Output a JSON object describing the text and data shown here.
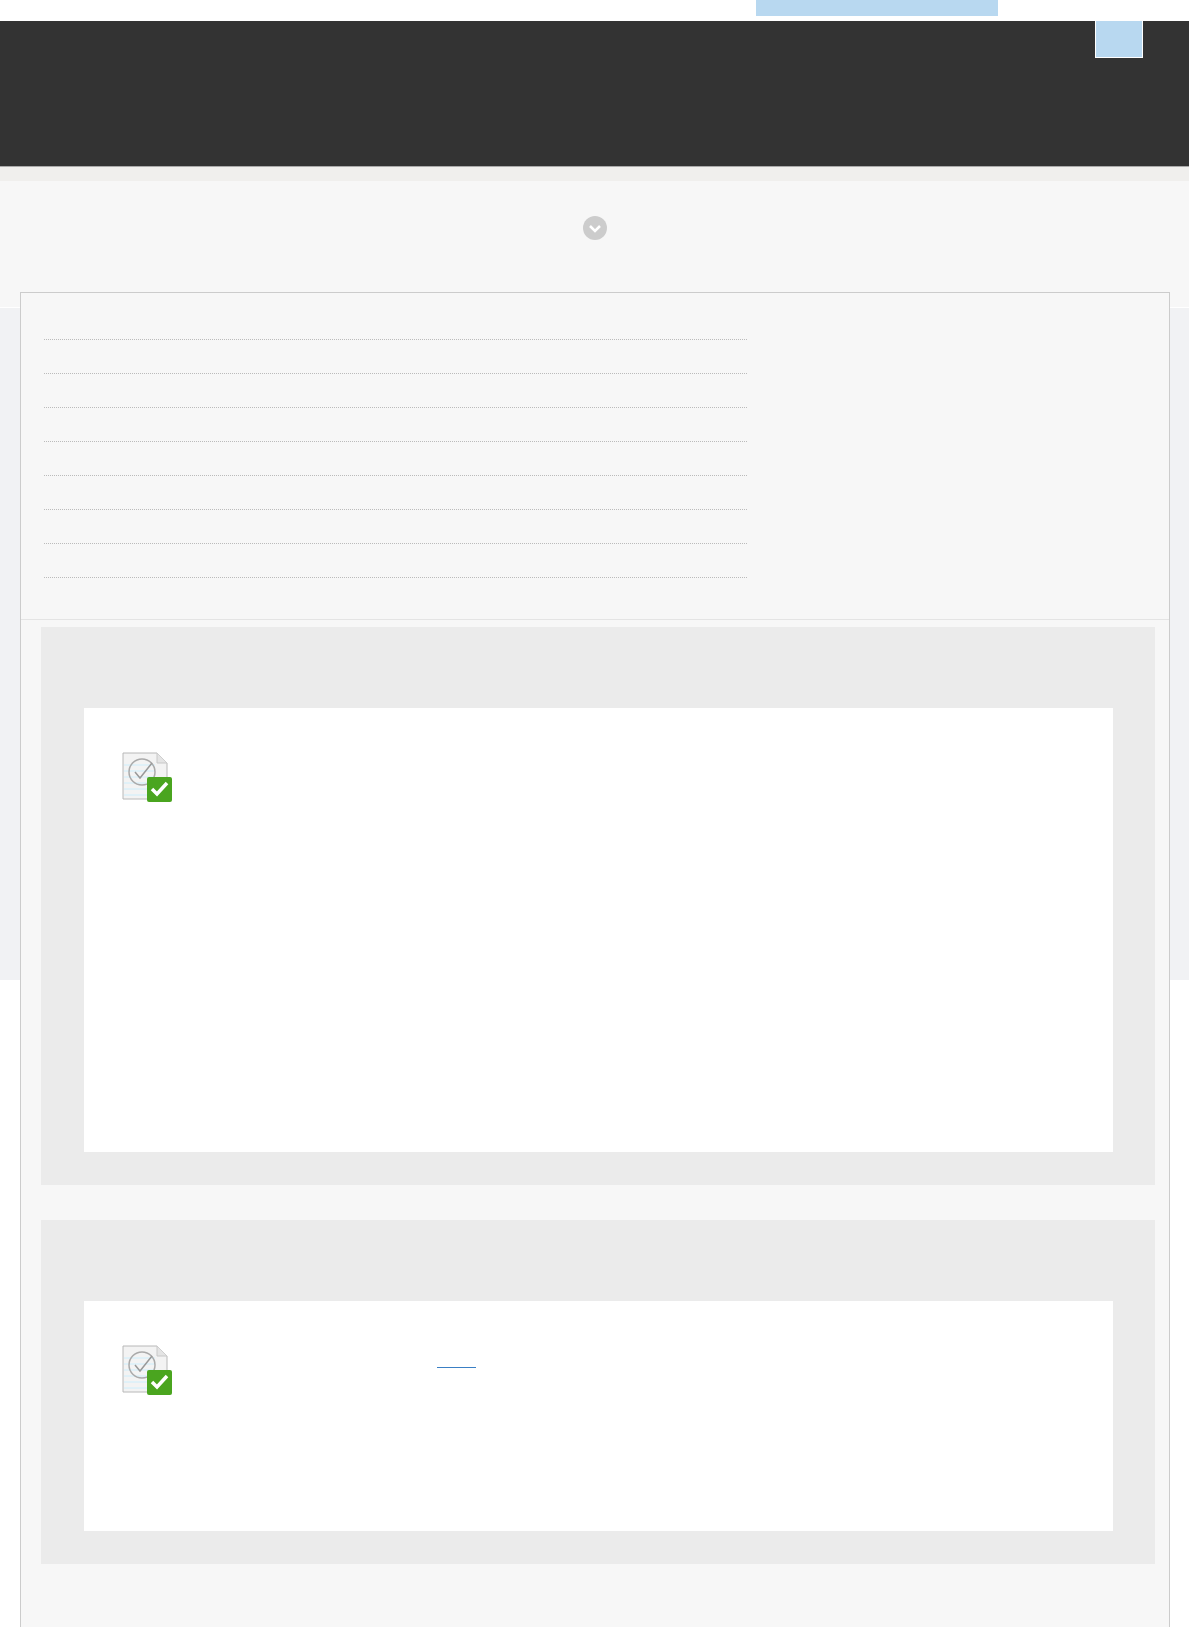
{
  "summary": {
    "rows": [
      {
        "kind": "dotted"
      },
      {
        "kind": "dotted"
      },
      {
        "kind": "dotted"
      },
      {
        "kind": "dotted"
      },
      {
        "kind": "dotted"
      },
      {
        "kind": "dotted"
      },
      {
        "kind": "dotted"
      },
      {
        "kind": "dotted"
      }
    ]
  },
  "panels": [
    {
      "kind": "document-check",
      "link": false
    },
    {
      "kind": "document-check",
      "link": true
    }
  ]
}
